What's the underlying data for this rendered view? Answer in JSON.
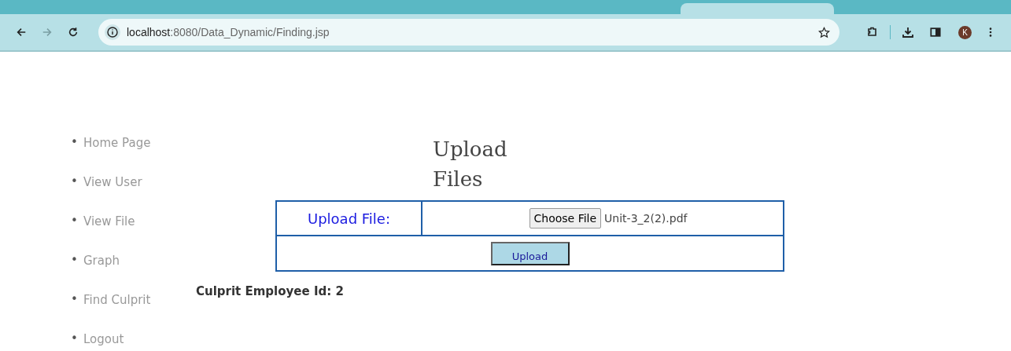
{
  "browser": {
    "url_host": "localhost",
    "url_path": ":8080/Data_Dynamic/Finding.jsp",
    "profile_initial": "K"
  },
  "sidebar": {
    "items": [
      {
        "bullet": "•",
        "label": "Home Page"
      },
      {
        "bullet": "•",
        "label": "View User"
      },
      {
        "bullet": "•",
        "label": "View File"
      },
      {
        "bullet": "•",
        "label": "Graph"
      },
      {
        "bullet": "•",
        "label": "Find Culprit"
      },
      {
        "bullet": "•",
        "label": "Logout"
      }
    ]
  },
  "heading": "Upload Files",
  "upload_form": {
    "label": "Upload File:",
    "choose_button": "Choose File",
    "file_name": "Unit-3_2(2).pdf",
    "submit_button": "Upload"
  },
  "result": "Culprit Employee Id: 2"
}
